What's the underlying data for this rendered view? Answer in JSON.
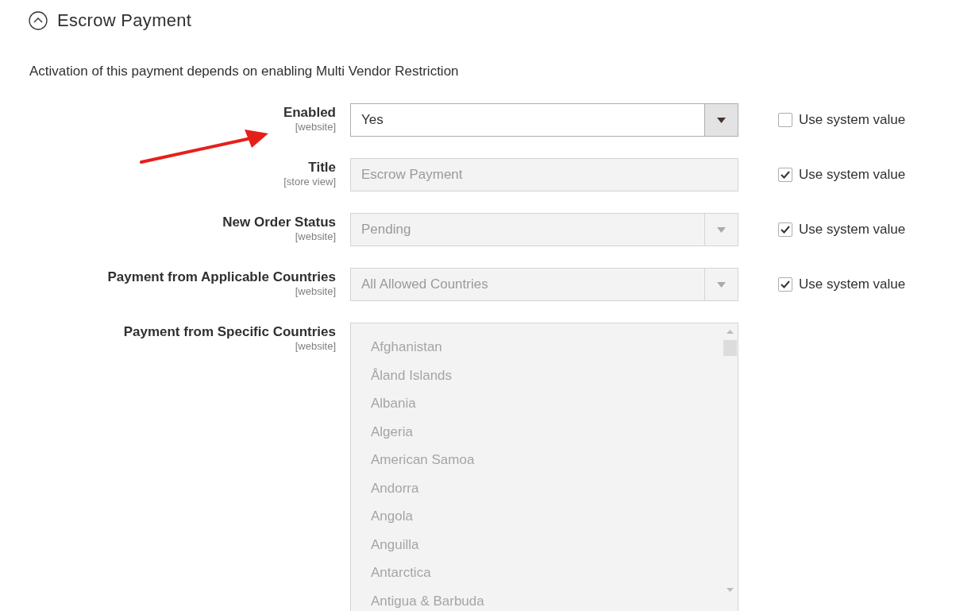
{
  "section": {
    "title": "Escrow Payment",
    "expanded": true
  },
  "note": "Activation of this payment depends on enabling Multi Vendor Restriction",
  "fields": [
    {
      "kind": "select",
      "label": "Enabled",
      "scope": "[website]",
      "value": "Yes",
      "disabled": false,
      "use_system_value": {
        "label": "Use system value",
        "checked": false
      }
    },
    {
      "kind": "text",
      "label": "Title",
      "scope": "[store view]",
      "value": "Escrow Payment",
      "disabled": true,
      "use_system_value": {
        "label": "Use system value",
        "checked": true
      }
    },
    {
      "kind": "select",
      "label": "New Order Status",
      "scope": "[website]",
      "value": "Pending",
      "disabled": true,
      "use_system_value": {
        "label": "Use system value",
        "checked": true
      }
    },
    {
      "kind": "select",
      "label": "Payment from Applicable Countries",
      "scope": "[website]",
      "value": "All Allowed Countries",
      "disabled": true,
      "use_system_value": {
        "label": "Use system value",
        "checked": true
      }
    },
    {
      "kind": "multiselect",
      "label": "Payment from Specific Countries",
      "scope": "[website]",
      "disabled": true,
      "options": [
        "Afghanistan",
        "Åland Islands",
        "Albania",
        "Algeria",
        "American Samoa",
        "Andorra",
        "Angola",
        "Anguilla",
        "Antarctica",
        "Antigua & Barbuda"
      ]
    }
  ]
}
